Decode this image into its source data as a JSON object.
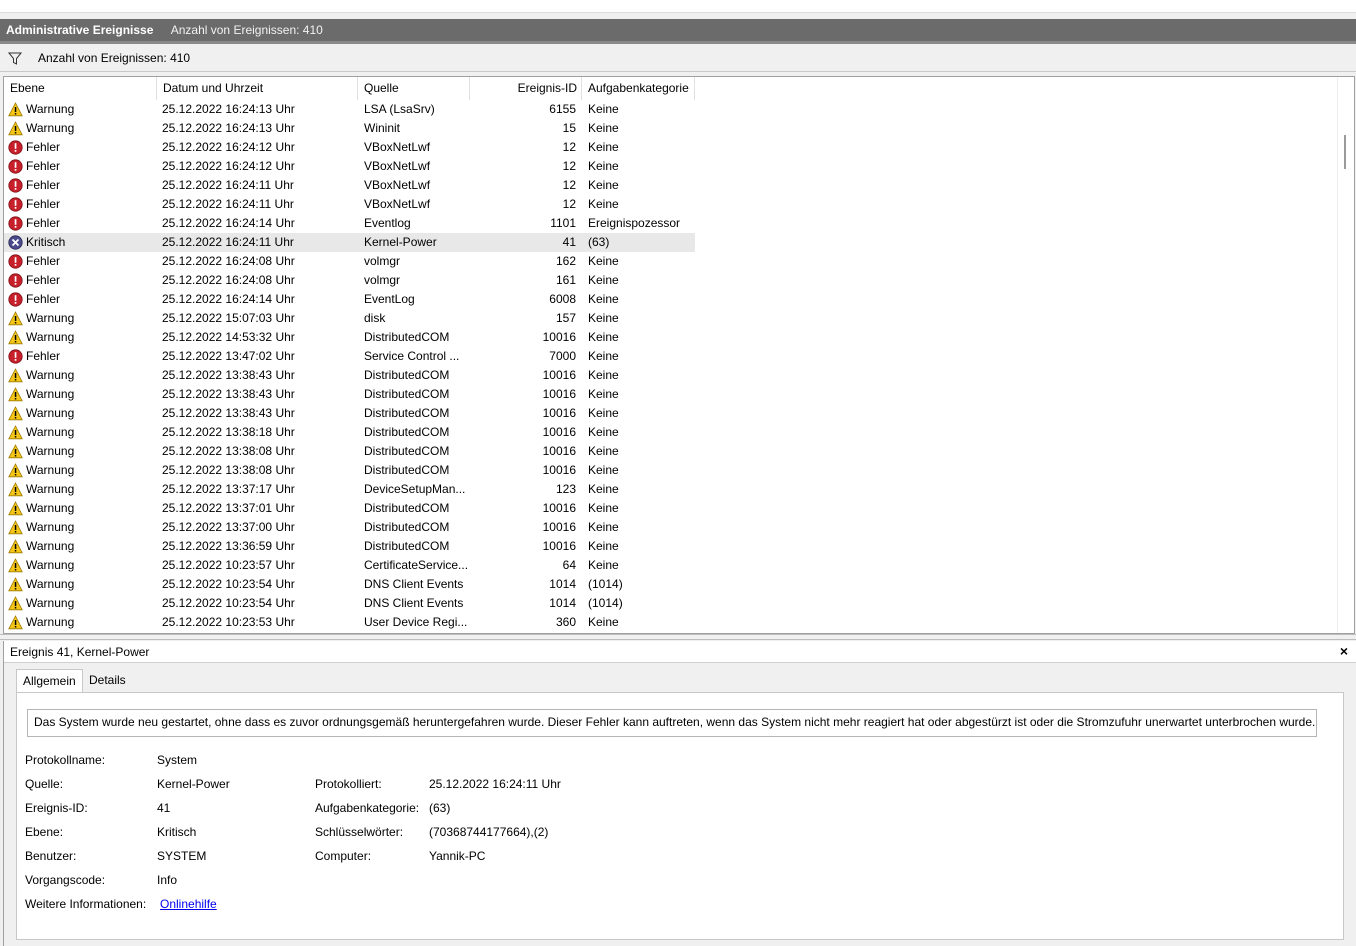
{
  "header": {
    "title": "Administrative Ereignisse",
    "count_label": "Anzahl von Ereignissen: 410"
  },
  "filter_bar": {
    "text": "Anzahl von Ereignissen: 410",
    "icon": "filter-icon"
  },
  "columns": [
    "Ebene",
    "Datum und Uhrzeit",
    "Quelle",
    "Ereignis-ID",
    "Aufgabenkategorie"
  ],
  "rows": [
    {
      "level": "Warnung",
      "icon": "warning-icon",
      "date": "25.12.2022 16:24:13 Uhr",
      "source": "LSA (LsaSrv)",
      "id": "6155",
      "category": "Keine"
    },
    {
      "level": "Warnung",
      "icon": "warning-icon",
      "date": "25.12.2022 16:24:13 Uhr",
      "source": "Wininit",
      "id": "15",
      "category": "Keine"
    },
    {
      "level": "Fehler",
      "icon": "error-icon",
      "date": "25.12.2022 16:24:12 Uhr",
      "source": "VBoxNetLwf",
      "id": "12",
      "category": "Keine"
    },
    {
      "level": "Fehler",
      "icon": "error-icon",
      "date": "25.12.2022 16:24:12 Uhr",
      "source": "VBoxNetLwf",
      "id": "12",
      "category": "Keine"
    },
    {
      "level": "Fehler",
      "icon": "error-icon",
      "date": "25.12.2022 16:24:11 Uhr",
      "source": "VBoxNetLwf",
      "id": "12",
      "category": "Keine"
    },
    {
      "level": "Fehler",
      "icon": "error-icon",
      "date": "25.12.2022 16:24:11 Uhr",
      "source": "VBoxNetLwf",
      "id": "12",
      "category": "Keine"
    },
    {
      "level": "Fehler",
      "icon": "error-icon",
      "date": "25.12.2022 16:24:14 Uhr",
      "source": "Eventlog",
      "id": "1101",
      "category": "Ereignispozessor"
    },
    {
      "level": "Kritisch",
      "icon": "critical-icon",
      "date": "25.12.2022 16:24:11 Uhr",
      "source": "Kernel-Power",
      "id": "41",
      "category": "(63)",
      "selected": true
    },
    {
      "level": "Fehler",
      "icon": "error-icon",
      "date": "25.12.2022 16:24:08 Uhr",
      "source": "volmgr",
      "id": "162",
      "category": "Keine"
    },
    {
      "level": "Fehler",
      "icon": "error-icon",
      "date": "25.12.2022 16:24:08 Uhr",
      "source": "volmgr",
      "id": "161",
      "category": "Keine"
    },
    {
      "level": "Fehler",
      "icon": "error-icon",
      "date": "25.12.2022 16:24:14 Uhr",
      "source": "EventLog",
      "id": "6008",
      "category": "Keine"
    },
    {
      "level": "Warnung",
      "icon": "warning-icon",
      "date": "25.12.2022 15:07:03 Uhr",
      "source": "disk",
      "id": "157",
      "category": "Keine"
    },
    {
      "level": "Warnung",
      "icon": "warning-icon",
      "date": "25.12.2022 14:53:32 Uhr",
      "source": "DistributedCOM",
      "id": "10016",
      "category": "Keine"
    },
    {
      "level": "Fehler",
      "icon": "error-icon",
      "date": "25.12.2022 13:47:02 Uhr",
      "source": "Service Control ...",
      "id": "7000",
      "category": "Keine"
    },
    {
      "level": "Warnung",
      "icon": "warning-icon",
      "date": "25.12.2022 13:38:43 Uhr",
      "source": "DistributedCOM",
      "id": "10016",
      "category": "Keine"
    },
    {
      "level": "Warnung",
      "icon": "warning-icon",
      "date": "25.12.2022 13:38:43 Uhr",
      "source": "DistributedCOM",
      "id": "10016",
      "category": "Keine"
    },
    {
      "level": "Warnung",
      "icon": "warning-icon",
      "date": "25.12.2022 13:38:43 Uhr",
      "source": "DistributedCOM",
      "id": "10016",
      "category": "Keine"
    },
    {
      "level": "Warnung",
      "icon": "warning-icon",
      "date": "25.12.2022 13:38:18 Uhr",
      "source": "DistributedCOM",
      "id": "10016",
      "category": "Keine"
    },
    {
      "level": "Warnung",
      "icon": "warning-icon",
      "date": "25.12.2022 13:38:08 Uhr",
      "source": "DistributedCOM",
      "id": "10016",
      "category": "Keine"
    },
    {
      "level": "Warnung",
      "icon": "warning-icon",
      "date": "25.12.2022 13:38:08 Uhr",
      "source": "DistributedCOM",
      "id": "10016",
      "category": "Keine"
    },
    {
      "level": "Warnung",
      "icon": "warning-icon",
      "date": "25.12.2022 13:37:17 Uhr",
      "source": "DeviceSetupMan...",
      "id": "123",
      "category": "Keine"
    },
    {
      "level": "Warnung",
      "icon": "warning-icon",
      "date": "25.12.2022 13:37:01 Uhr",
      "source": "DistributedCOM",
      "id": "10016",
      "category": "Keine"
    },
    {
      "level": "Warnung",
      "icon": "warning-icon",
      "date": "25.12.2022 13:37:00 Uhr",
      "source": "DistributedCOM",
      "id": "10016",
      "category": "Keine"
    },
    {
      "level": "Warnung",
      "icon": "warning-icon",
      "date": "25.12.2022 13:36:59 Uhr",
      "source": "DistributedCOM",
      "id": "10016",
      "category": "Keine"
    },
    {
      "level": "Warnung",
      "icon": "warning-icon",
      "date": "25.12.2022 10:23:57 Uhr",
      "source": "CertificateService...",
      "id": "64",
      "category": "Keine"
    },
    {
      "level": "Warnung",
      "icon": "warning-icon",
      "date": "25.12.2022 10:23:54 Uhr",
      "source": "DNS Client Events",
      "id": "1014",
      "category": "(1014)"
    },
    {
      "level": "Warnung",
      "icon": "warning-icon",
      "date": "25.12.2022 10:23:54 Uhr",
      "source": "DNS Client Events",
      "id": "1014",
      "category": "(1014)"
    },
    {
      "level": "Warnung",
      "icon": "warning-icon",
      "date": "25.12.2022 10:23:53 Uhr",
      "source": "User Device Regi...",
      "id": "360",
      "category": "Keine"
    }
  ],
  "detail": {
    "title": "Ereignis 41, Kernel-Power",
    "close_label": "×",
    "tabs": [
      "Allgemein",
      "Details"
    ],
    "description": "Das System wurde neu gestartet, ohne dass es zuvor ordnungsgemäß heruntergefahren wurde. Dieser Fehler kann auftreten, wenn das System nicht mehr reagiert hat oder abgestürzt ist oder die Stromzufuhr unerwartet unterbrochen wurde.",
    "fields_left": [
      {
        "label": "Protokollname:",
        "value": "System"
      },
      {
        "label": "Quelle:",
        "value": "Kernel-Power"
      },
      {
        "label": "Ereignis-ID:",
        "value": "41"
      },
      {
        "label": "Ebene:",
        "value": "Kritisch"
      },
      {
        "label": "Benutzer:",
        "value": "SYSTEM"
      },
      {
        "label": "Vorgangscode:",
        "value": "Info"
      },
      {
        "label": "Weitere Informationen:",
        "value": "Onlinehilfe",
        "link": true
      }
    ],
    "fields_right": [
      {
        "label": "Protokolliert:",
        "value": "25.12.2022 16:24:11 Uhr"
      },
      {
        "label": "Aufgabenkategorie:",
        "value": "(63)"
      },
      {
        "label": "Schlüsselwörter:",
        "value": "(70368744177664),(2)"
      },
      {
        "label": "Computer:",
        "value": "Yannik-PC"
      }
    ]
  },
  "colors": {
    "titlebar": "#6b6b6b",
    "warning": "#f5c518",
    "error": "#c8202b",
    "critical": "#4a4a8c",
    "selected_row": "#e8e8e8",
    "link": "#0000ee"
  }
}
